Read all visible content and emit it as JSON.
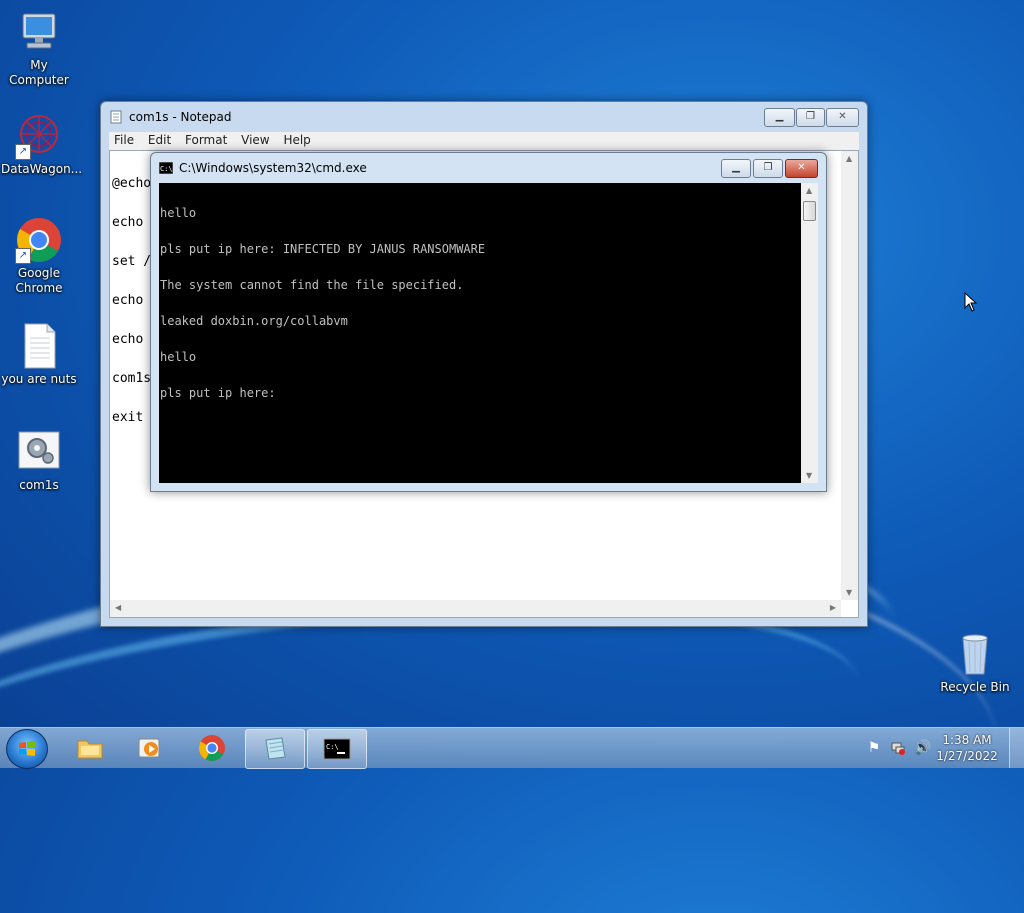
{
  "desktop": {
    "icons": [
      {
        "label": "My Computer"
      },
      {
        "label": "DataWagon..."
      },
      {
        "label": "Google Chrome"
      },
      {
        "label": "you are nuts"
      },
      {
        "label": "com1s"
      },
      {
        "label": "Recycle Bin"
      }
    ]
  },
  "notepad": {
    "title": "com1s - Notepad",
    "menu": [
      "File",
      "Edit",
      "Format",
      "View",
      "Help"
    ],
    "lines": [
      "@echo",
      "echo",
      "set /",
      "echo",
      "echo",
      "com1s",
      "exit"
    ]
  },
  "cmd": {
    "title": "C:\\Windows\\system32\\cmd.exe",
    "lines": [
      "hello",
      "pls put ip here: INFECTED BY JANUS RANSOMWARE",
      "The system cannot find the file specified.",
      "leaked doxbin.org/collabvm",
      "hello",
      "pls put ip here:"
    ]
  },
  "taskbar": {
    "time": "1:38 AM",
    "date": "1/27/2022"
  },
  "colors": {
    "desktop_blue": "#0e5bb8",
    "cmd_bg": "#000000",
    "cmd_fg": "#c0c0c0",
    "close_red": "#c4442d"
  }
}
